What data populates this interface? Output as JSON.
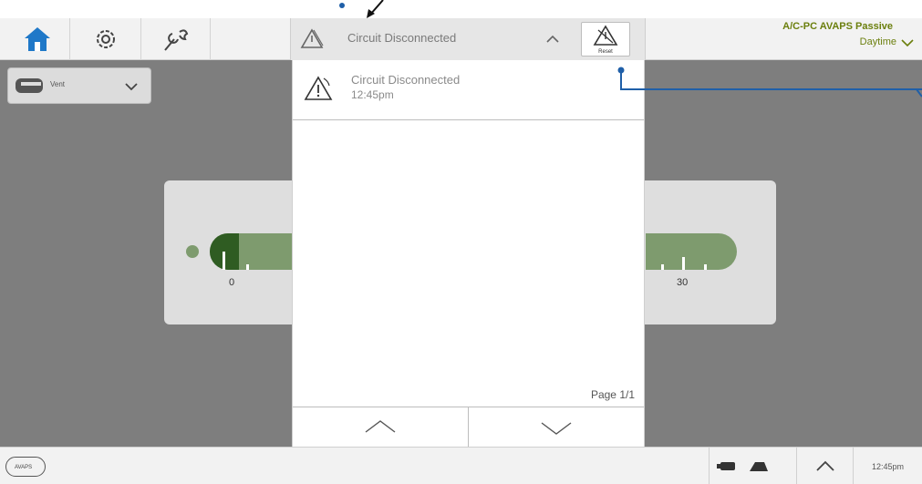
{
  "topbar": {
    "home_icon": "home-icon",
    "settings_icon": "gear-icon",
    "tools_icon": "wrench-icon",
    "alarm": {
      "icon": "alarm-triangle-icon",
      "text": "Circuit Disconnected",
      "expand_icon": "chevron-up-icon",
      "reset_icon": "alarm-reset-icon",
      "reset_label": "Reset"
    },
    "mode": {
      "line1": "A/C-PC AVAPS Passive",
      "line2": "Daytime",
      "color": "#6b7f0d"
    }
  },
  "main": {
    "view_selector": {
      "icon": "ventilator-icon",
      "label": "Vent",
      "chevron": "chevron-down-icon"
    },
    "gauge": {
      "min_label": "0",
      "max_label": "30",
      "color_light": "#7e9b6e",
      "color_dark": "#2f5c22"
    }
  },
  "alarm_panel": {
    "entries": [
      {
        "icon": "alarm-triangle-icon",
        "title": "Circuit Disconnected",
        "time": "12:45pm"
      }
    ],
    "page_label": "Page 1/1",
    "up_icon": "chevron-up-icon",
    "down_icon": "chevron-down-icon"
  },
  "bottombar": {
    "avaps_label": "AVAPS",
    "power_icon": "battery-icon",
    "ac_icon": "plug-icon",
    "expand_icon": "chevron-up-icon",
    "time": "12:45pm"
  },
  "annotation_color": "#1f5fa8"
}
